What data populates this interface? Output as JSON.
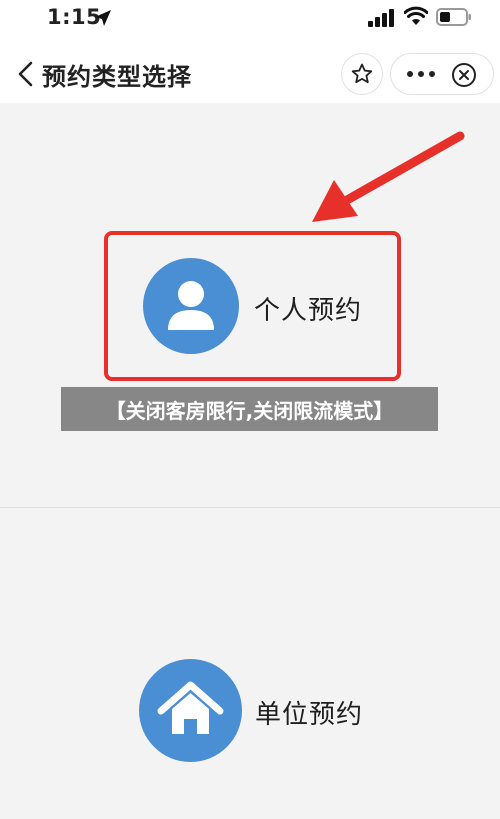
{
  "status_bar": {
    "time": "1:15",
    "icons": [
      "location-arrow-icon",
      "signal-icon",
      "wifi-icon",
      "battery-icon"
    ]
  },
  "nav": {
    "title": "预约类型选择",
    "back_icon": "chevron-left-icon",
    "favorite_icon": "star-outline-icon",
    "more_icon": "more-dots-icon",
    "close_icon": "close-circle-icon"
  },
  "options": [
    {
      "label": "个人预约",
      "icon": "person-icon"
    },
    {
      "label": "单位预约",
      "icon": "house-icon"
    }
  ],
  "banner_text": "【关闭客房限行,关闭限流模式】",
  "colors": {
    "accent_blue": "#4a8fd4",
    "highlight_red": "#e8302a",
    "banner_gray": "#878787",
    "background": "#f3f3f3"
  }
}
